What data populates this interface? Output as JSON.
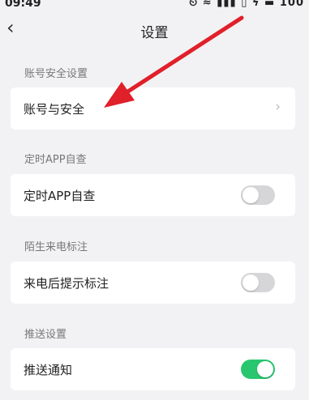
{
  "status_bar": {
    "time": "09:49",
    "battery": "100",
    "icons": [
      "alarm-icon",
      "wifi-icon",
      "signal-icon",
      "data-icon",
      "charging-icon",
      "battery-icon"
    ]
  },
  "nav": {
    "back_icon": "chevron-left-icon",
    "title": "设置"
  },
  "sections": [
    {
      "label": "账号安全设置",
      "row": {
        "label": "账号与安全",
        "control": "chevron"
      }
    },
    {
      "label": "定时APP自查",
      "row": {
        "label": "定时APP自查",
        "control": "toggle",
        "on": false
      }
    },
    {
      "label": "陌生来电标注",
      "row": {
        "label": "来电后提示标注",
        "control": "toggle",
        "on": false
      }
    },
    {
      "label": "推送设置",
      "row": {
        "label": "推送通知",
        "control": "toggle",
        "on": true
      }
    }
  ],
  "colors": {
    "background": "#f2f2f4",
    "toggle_on": "#28c76f",
    "toggle_off": "#d6d6d8",
    "annotation_arrow": "#e0202a"
  }
}
